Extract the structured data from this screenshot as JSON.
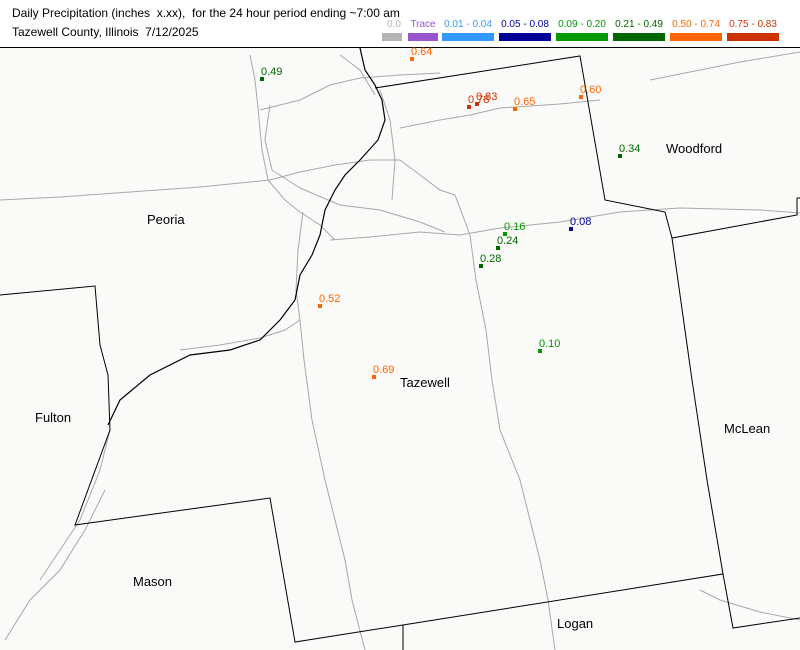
{
  "header": {
    "title_line1": "Daily Precipitation (inches  x.xx),  for the 24 hour period ending ~7:00 am",
    "title_line2": "Tazewell County, Illinois  7/12/2025"
  },
  "legend": [
    {
      "label": "0.0",
      "color": "#b4b4b4"
    },
    {
      "label": "Trace",
      "color": "#9955cc"
    },
    {
      "label": "0.01 - 0.04",
      "color": "#3399ff"
    },
    {
      "label": "0.05 - 0.08",
      "color": "#000099"
    },
    {
      "label": "0.09 - 0.20",
      "color": "#009900"
    },
    {
      "label": "0.21 - 0.49",
      "color": "#006600"
    },
    {
      "label": "0.50 - 0.74",
      "color": "#ff6600"
    },
    {
      "label": "0.75 - 0.83",
      "color": "#cc3300"
    }
  ],
  "counties": {
    "peoria": "Peoria",
    "woodford": "Woodford",
    "fulton": "Fulton",
    "tazewell": "Tazewell",
    "mclean": "McLean",
    "mason": "Mason",
    "logan": "Logan"
  },
  "stations": [
    {
      "value": "0.64",
      "color": "#ff6600"
    },
    {
      "value": "0.49",
      "color": "#006600"
    },
    {
      "value": "0.83",
      "color": "#cc3300"
    },
    {
      "value": "0.78",
      "color": "#cc3300"
    },
    {
      "value": "0.65",
      "color": "#ff6600"
    },
    {
      "value": "0.60",
      "color": "#ff6600"
    },
    {
      "value": "0.34",
      "color": "#006600"
    },
    {
      "value": "0.16",
      "color": "#009900"
    },
    {
      "value": "0.08",
      "color": "#000099"
    },
    {
      "value": "0.24",
      "color": "#006600"
    },
    {
      "value": "0.28",
      "color": "#006600"
    },
    {
      "value": "0.52",
      "color": "#ff6600"
    },
    {
      "value": "0.10",
      "color": "#009900"
    },
    {
      "value": "0.69",
      "color": "#ff6600"
    }
  ]
}
